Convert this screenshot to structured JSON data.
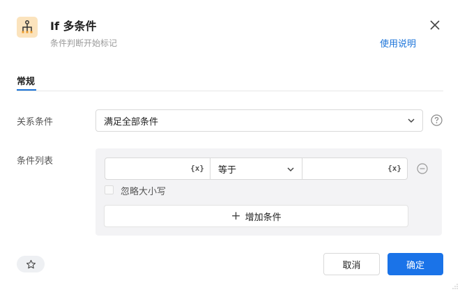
{
  "header": {
    "title": "If 多条件",
    "subtitle": "条件判断开始标记",
    "help_link": "使用说明",
    "icon": "branch-condition-icon"
  },
  "tabs": [
    {
      "label": "常规",
      "active": true
    }
  ],
  "relation": {
    "label": "关系条件",
    "value": "满足全部条件"
  },
  "conditions": {
    "label": "条件列表",
    "rows": [
      {
        "left_value": "",
        "left_var_tag": "{x}",
        "operator": "等于",
        "right_value": "",
        "right_var_tag": "{x}"
      }
    ],
    "ignore_case_label": "忽略大小写",
    "ignore_case_checked": false,
    "add_button": "增加条件"
  },
  "footer": {
    "cancel": "取消",
    "ok": "确定"
  },
  "colors": {
    "accent": "#1a73e8",
    "link": "#1a73d9",
    "icon_bg": "#fbe3bd",
    "panel_bg": "#f3f3f5"
  }
}
